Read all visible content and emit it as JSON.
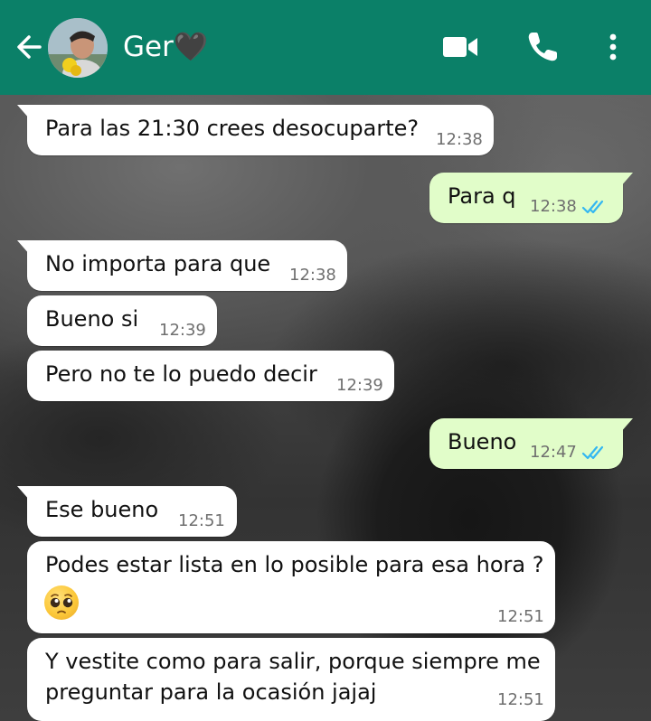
{
  "header": {
    "contact_name": "Ger🖤",
    "icons": [
      "back-arrow-icon",
      "video-call-icon",
      "phone-icon",
      "more-vertical-icon"
    ]
  },
  "messages": [
    {
      "dir": "in",
      "text": "Para las 21:30 crees desocuparte?",
      "time": "12:38"
    },
    {
      "dir": "out",
      "text": "Para q",
      "time": "12:38",
      "status": "read"
    },
    {
      "dir": "in",
      "text": "No importa para que",
      "time": "12:38"
    },
    {
      "dir": "in",
      "text": "Bueno si",
      "time": "12:39"
    },
    {
      "dir": "in",
      "text": "Pero no te lo puedo decir",
      "time": "12:39"
    },
    {
      "dir": "out",
      "text": "Bueno",
      "time": "12:47",
      "status": "read"
    },
    {
      "dir": "in",
      "text": "Ese bueno",
      "time": "12:51"
    },
    {
      "dir": "in",
      "text": "Podes estar lista en lo posible para esa hora ?",
      "emoji": "pleading-face",
      "time": "12:51"
    },
    {
      "dir": "in",
      "text_line1": "Y vestite como para salir, porque siempre me",
      "text_line2": "preguntar para la ocasión jajaj",
      "time": "12:51"
    }
  ],
  "colors": {
    "header": "#0b8068",
    "incoming_bubble": "#ffffff",
    "outgoing_bubble": "#e1fdc9",
    "read_ticks": "#34b7f1"
  }
}
